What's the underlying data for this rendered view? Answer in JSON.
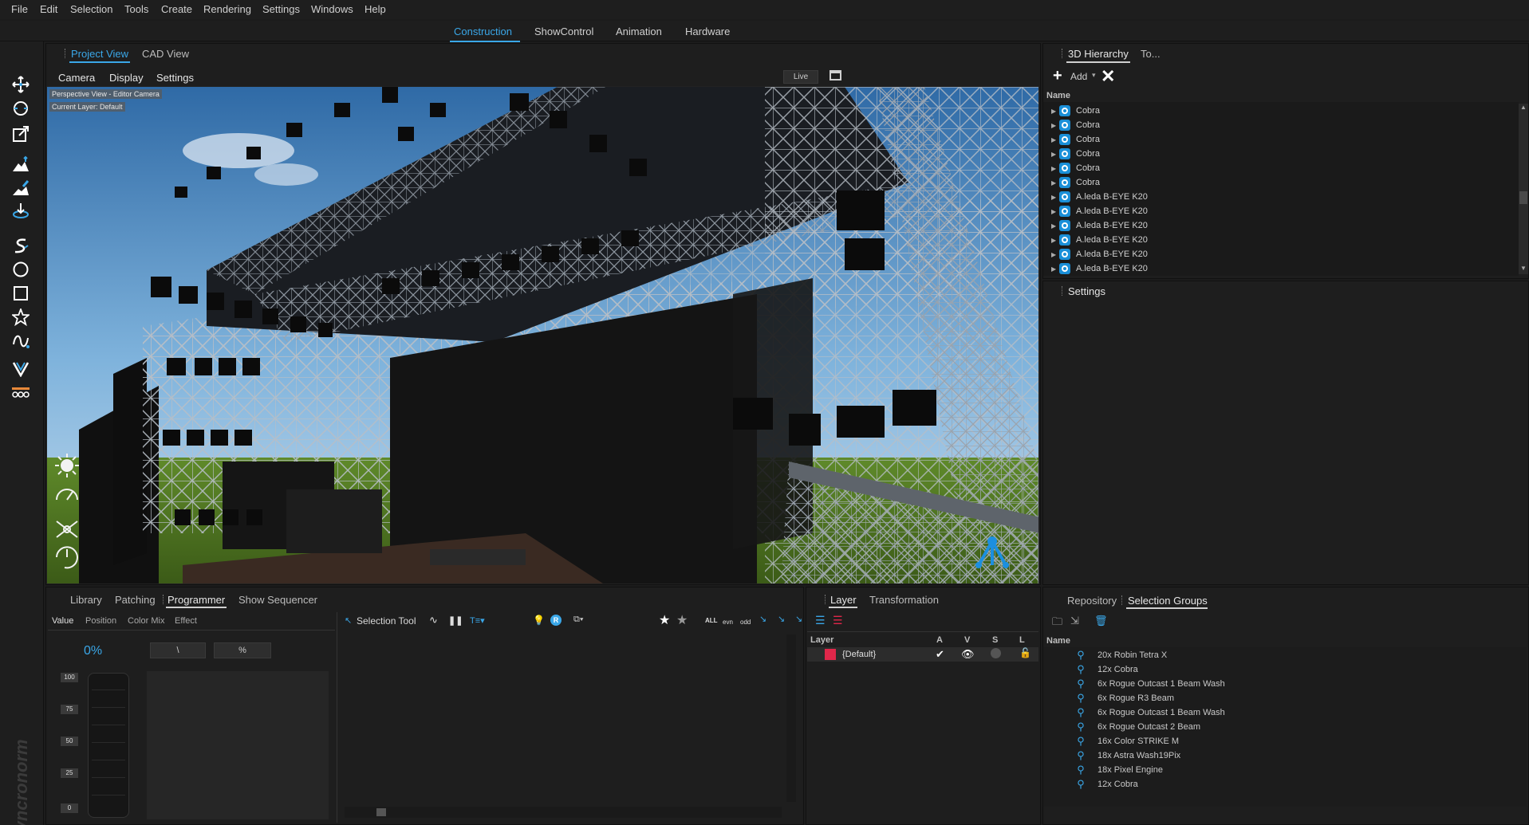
{
  "menu": [
    "File",
    "Edit",
    "Selection",
    "Tools",
    "Create",
    "Rendering",
    "Settings",
    "Windows",
    "Help"
  ],
  "modes": [
    "Construction",
    "ShowControl",
    "Animation",
    "Hardware"
  ],
  "view_tabs": [
    "Project View",
    "CAD View"
  ],
  "view_menu": [
    "Camera",
    "Display",
    "Settings"
  ],
  "live_label": "Live",
  "viewport_tags": [
    "Perspective View - Editor Camera",
    "Current Layer: Default"
  ],
  "hierarchy": {
    "tabs": [
      "3D Hierarchy",
      "To..."
    ],
    "add_label": "Add",
    "name_header": "Name",
    "items": [
      "Cobra",
      "Cobra",
      "Cobra",
      "Cobra",
      "Cobra",
      "Cobra",
      "A.leda B-EYE K20",
      "A.leda B-EYE K20",
      "A.leda B-EYE K20",
      "A.leda B-EYE K20",
      "A.leda B-EYE K20",
      "A.leda B-EYE K20"
    ],
    "settings_label": "Settings"
  },
  "bottom_tabs": [
    "Library",
    "Patching",
    "Programmer",
    "Show Sequencer"
  ],
  "programmer": {
    "subtabs": [
      "Value",
      "Position",
      "Color Mix",
      "Effect"
    ],
    "percent": "0%",
    "btn1": "\\",
    "btn2": "%",
    "scale": [
      "100",
      "75",
      "50",
      "25",
      "0"
    ],
    "selection_tool": "Selection Tool",
    "filters": [
      "ALL",
      "evn",
      "odd"
    ]
  },
  "layer_panel": {
    "tabs": [
      "Layer",
      "Transformation"
    ],
    "headers": [
      "Layer",
      "A",
      "V",
      "S",
      "L"
    ],
    "row": "{Default}",
    "row_color": "#e0274a"
  },
  "groups_panel": {
    "tabs": [
      "Repository",
      "Selection Groups"
    ],
    "name_header": "Name",
    "items": [
      "20x Robin Tetra X",
      "12x Cobra",
      "6x Rogue Outcast 1 Beam Wash",
      "6x Rogue R3 Beam",
      "6x Rogue Outcast 1 Beam Wash",
      "6x Rogue Outcast 2 Beam",
      "16x Color STRIKE M",
      "18x Astra Wash19Pix",
      "18x Pixel Engine",
      "12x Cobra"
    ]
  },
  "brand": "Syncronorm",
  "colors": {
    "accent": "#3aa7e8",
    "bg": "#1e1e1e"
  }
}
